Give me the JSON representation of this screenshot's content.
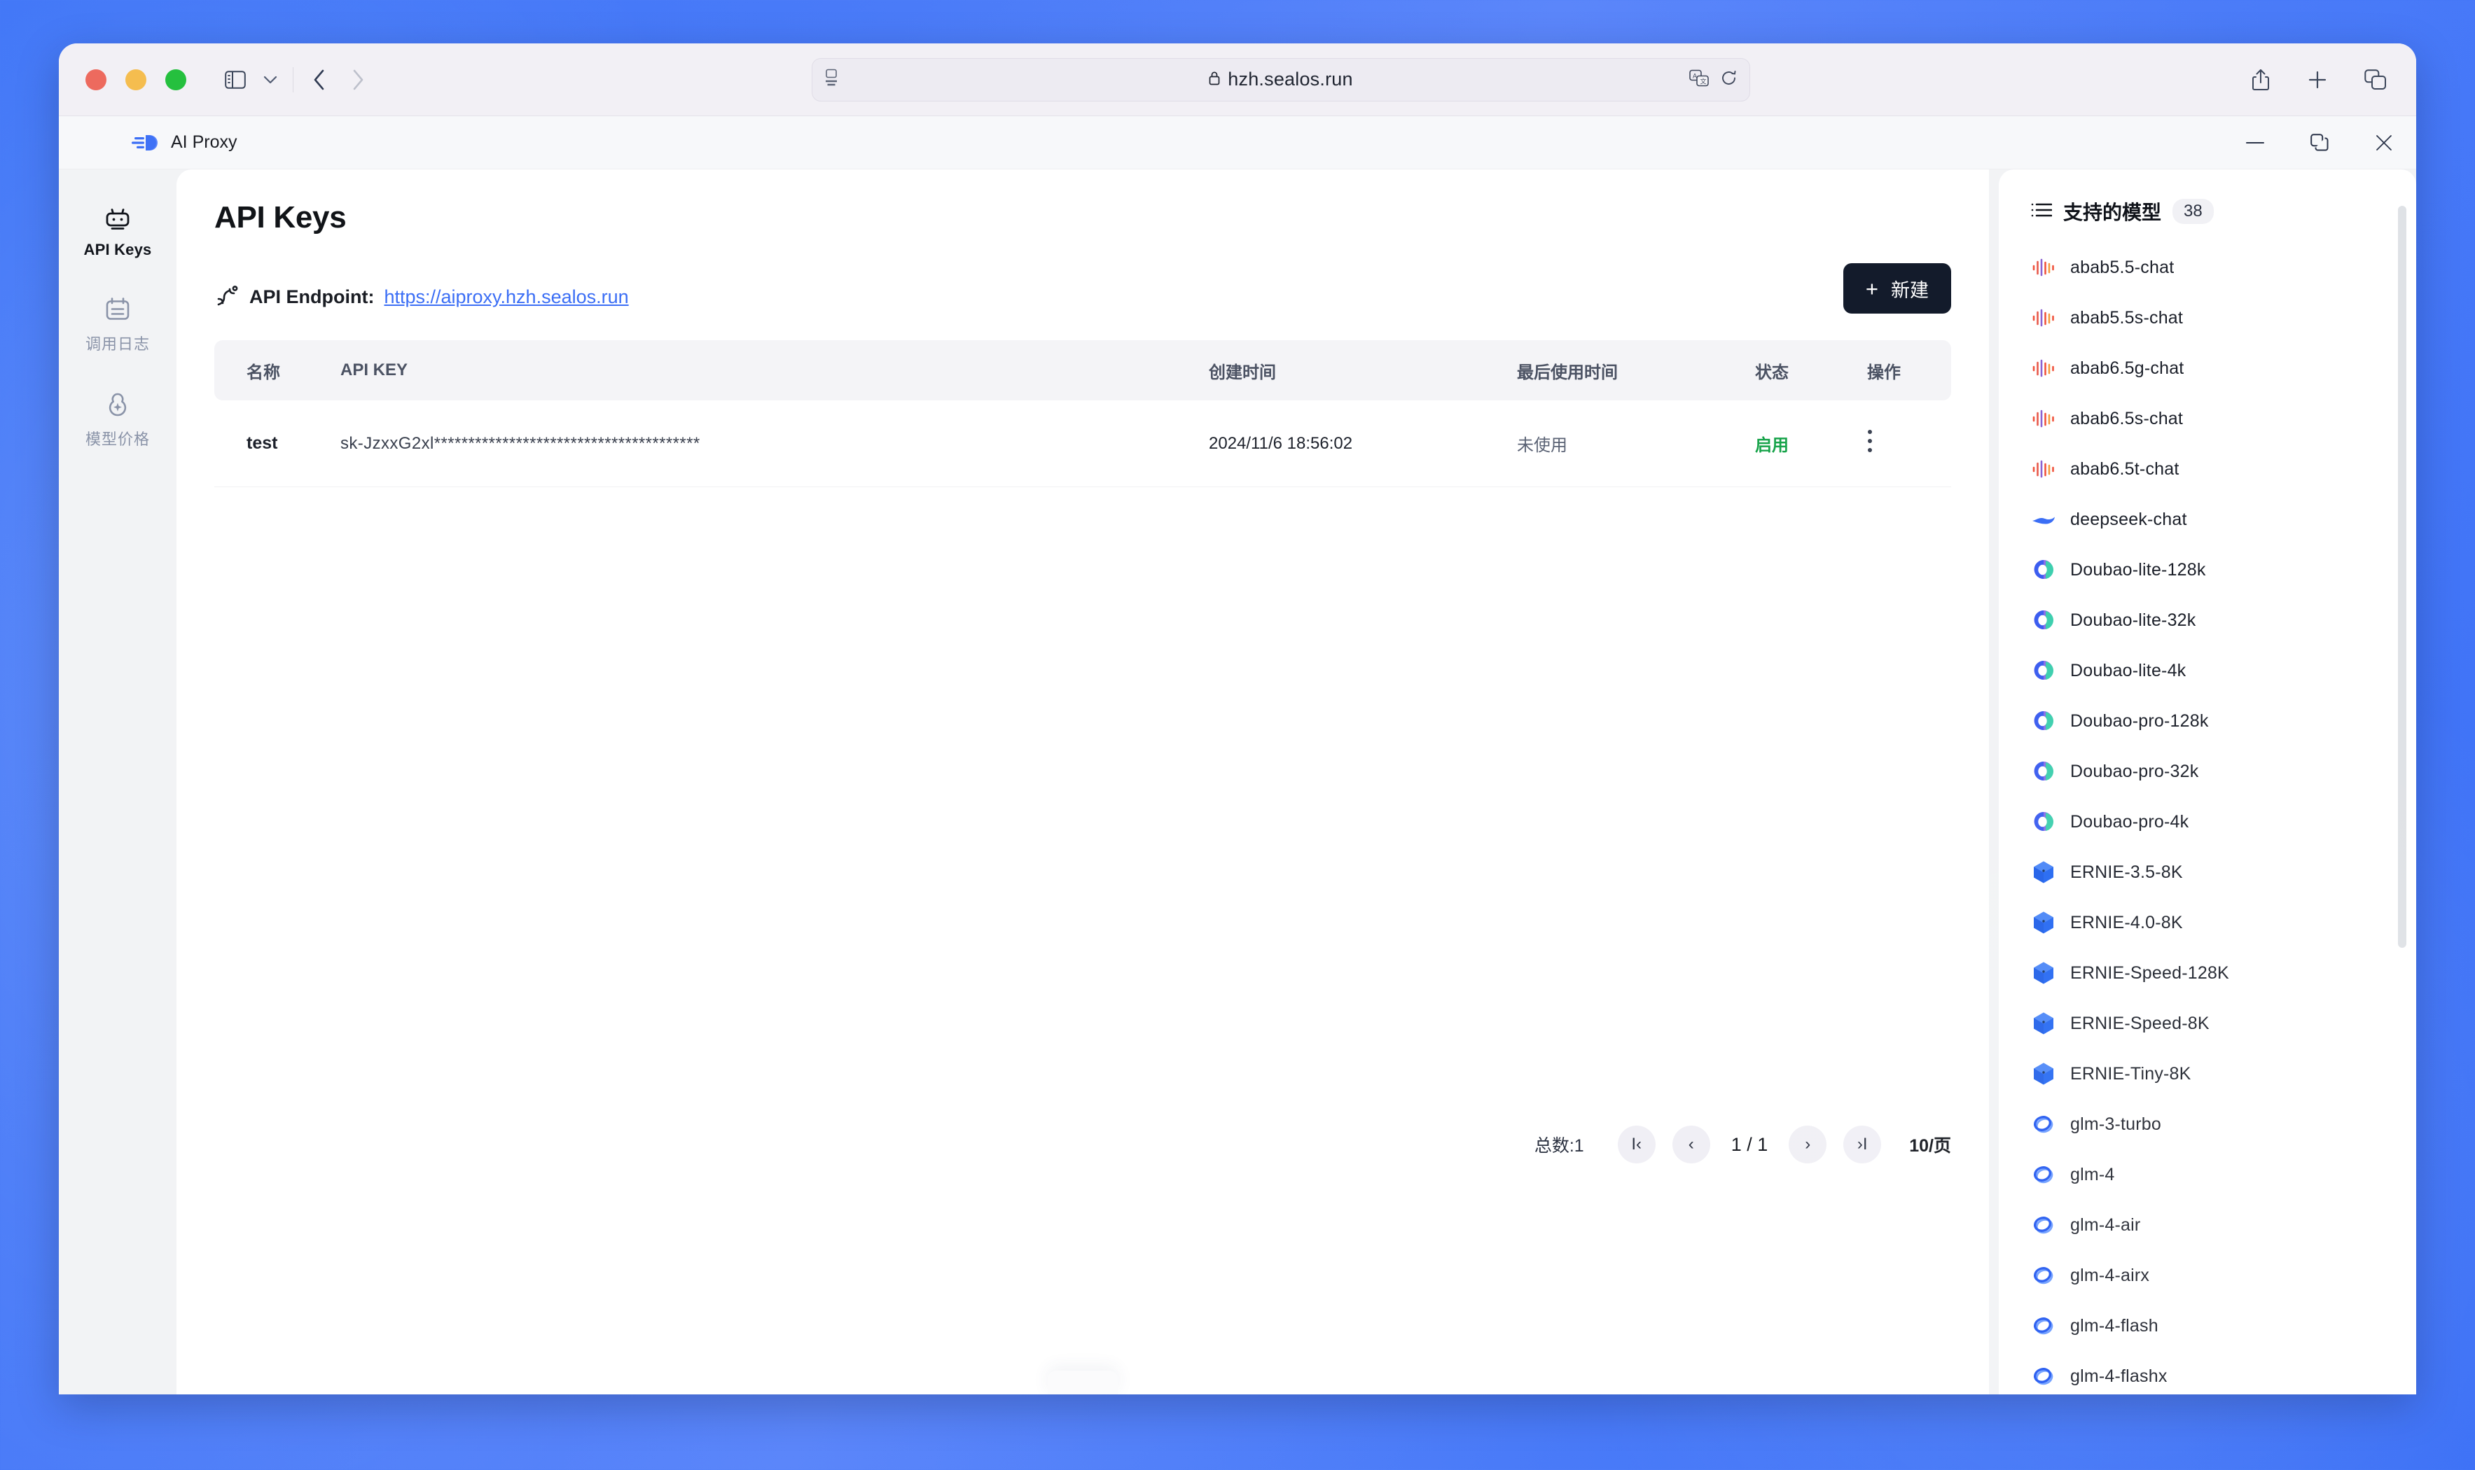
{
  "browser": {
    "url": "hzh.sealos.run",
    "lock_icon": "lock-icon",
    "reader_icon": "reader-view-icon",
    "translate_icon": "translate-icon",
    "reload_icon": "reload-icon",
    "sidebar_icon": "sidebar-toggle-icon",
    "back_icon": "back-chevron-icon",
    "forward_icon": "forward-chevron-icon",
    "share_icon": "share-icon",
    "newtab_icon": "new-tab-icon",
    "tabs_icon": "tab-overview-icon"
  },
  "app": {
    "title": "AI Proxy",
    "minimize_label": "—",
    "maximize_label": "❐",
    "close_label": "✕"
  },
  "rail": {
    "items": [
      {
        "label": "API Keys",
        "icon": "robot-icon",
        "active": true
      },
      {
        "label": "调用日志",
        "icon": "logs-calendar-icon",
        "active": false
      },
      {
        "label": "模型价格",
        "icon": "price-cloud-icon",
        "active": false
      }
    ]
  },
  "page": {
    "title": "API Keys",
    "endpoint_label": "API Endpoint:",
    "endpoint_url": "https://aiproxy.hzh.sealos.run",
    "endpoint_icon": "link-dna-icon",
    "new_button": {
      "label": "新建",
      "plus": "+"
    }
  },
  "table": {
    "columns": [
      "名称",
      "API KEY",
      "创建时间",
      "最后使用时间",
      "状态",
      "操作"
    ],
    "rows": [
      {
        "name": "test",
        "api_key": "sk-JzxxG2xl***************************************",
        "created_at": "2024/11/6 18:56:02",
        "last_used": "未使用",
        "status": "启用",
        "action_icon": "more-vertical-icon"
      }
    ]
  },
  "pagination": {
    "total_label": "总数:1",
    "first_label": "I‹",
    "prev_label": "‹",
    "index_label": "1 / 1",
    "next_label": "›",
    "last_label": "›I",
    "page_size_label": "10/页"
  },
  "models_panel": {
    "icon": "list-icon",
    "title": "支持的模型",
    "count": "38",
    "items": [
      {
        "name": "abab5.5-chat",
        "icon": "minimax-wave-icon",
        "brand": "minimax"
      },
      {
        "name": "abab5.5s-chat",
        "icon": "minimax-wave-icon",
        "brand": "minimax"
      },
      {
        "name": "abab6.5g-chat",
        "icon": "minimax-wave-icon",
        "brand": "minimax"
      },
      {
        "name": "abab6.5s-chat",
        "icon": "minimax-wave-icon",
        "brand": "minimax"
      },
      {
        "name": "abab6.5t-chat",
        "icon": "minimax-wave-icon",
        "brand": "minimax"
      },
      {
        "name": "deepseek-chat",
        "icon": "deepseek-whale-icon",
        "brand": "deepseek"
      },
      {
        "name": "Doubao-lite-128k",
        "icon": "doubao-icon",
        "brand": "doubao"
      },
      {
        "name": "Doubao-lite-32k",
        "icon": "doubao-icon",
        "brand": "doubao"
      },
      {
        "name": "Doubao-lite-4k",
        "icon": "doubao-icon",
        "brand": "doubao"
      },
      {
        "name": "Doubao-pro-128k",
        "icon": "doubao-icon",
        "brand": "doubao"
      },
      {
        "name": "Doubao-pro-32k",
        "icon": "doubao-icon",
        "brand": "doubao"
      },
      {
        "name": "Doubao-pro-4k",
        "icon": "doubao-icon",
        "brand": "doubao"
      },
      {
        "name": "ERNIE-3.5-8K",
        "icon": "ernie-cube-icon",
        "brand": "ernie"
      },
      {
        "name": "ERNIE-4.0-8K",
        "icon": "ernie-cube-icon",
        "brand": "ernie"
      },
      {
        "name": "ERNIE-Speed-128K",
        "icon": "ernie-cube-icon",
        "brand": "ernie"
      },
      {
        "name": "ERNIE-Speed-8K",
        "icon": "ernie-cube-icon",
        "brand": "ernie"
      },
      {
        "name": "ERNIE-Tiny-8K",
        "icon": "ernie-cube-icon",
        "brand": "ernie"
      },
      {
        "name": "glm-3-turbo",
        "icon": "zhipu-ring-icon",
        "brand": "zhipu"
      },
      {
        "name": "glm-4",
        "icon": "zhipu-ring-icon",
        "brand": "zhipu"
      },
      {
        "name": "glm-4-air",
        "icon": "zhipu-ring-icon",
        "brand": "zhipu"
      },
      {
        "name": "glm-4-airx",
        "icon": "zhipu-ring-icon",
        "brand": "zhipu"
      },
      {
        "name": "glm-4-flash",
        "icon": "zhipu-ring-icon",
        "brand": "zhipu"
      },
      {
        "name": "glm-4-flashx",
        "icon": "zhipu-ring-icon",
        "brand": "zhipu"
      }
    ]
  },
  "colors": {
    "accent": "#3b6ef5",
    "status_enabled": "#17a34a",
    "button_dark": "#131b2b",
    "desktop_bg": "#4a7bf8"
  }
}
